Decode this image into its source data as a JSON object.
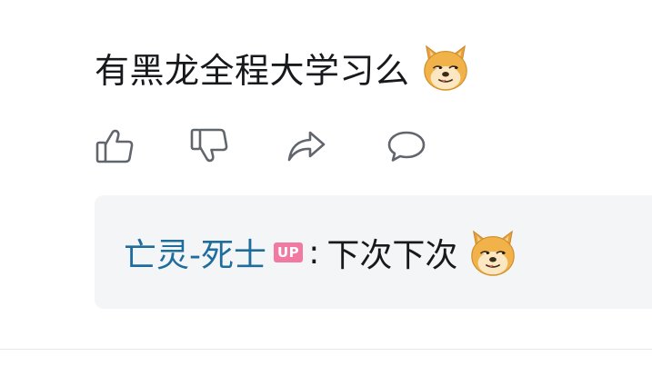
{
  "comment": {
    "text": "有黑龙全程大学习么",
    "emoji_icon": "doge-emoji-icon"
  },
  "actions": {
    "like_icon": "thumb-up-icon",
    "dislike_icon": "thumb-down-icon",
    "share_icon": "share-arrow-icon",
    "reply_icon": "speech-bubble-icon"
  },
  "reply": {
    "username": "亡灵-死士",
    "badge": "UP",
    "separator": ":",
    "text": "下次下次",
    "emoji_icon": "doge-emoji-icon"
  },
  "colors": {
    "username": "#1e6d9c",
    "badge_bg": "#f27aa2",
    "reply_bg": "#f4f5f7",
    "icon_stroke": "#61666d",
    "text": "#18191c"
  }
}
